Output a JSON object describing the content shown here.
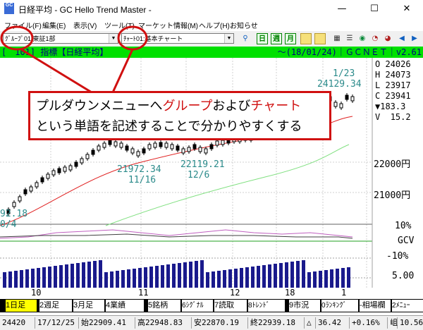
{
  "window": {
    "title": "日経平均 - GC Hello Trend Master -",
    "icon_text": "GC",
    "minimize": "—",
    "maximize": "☐",
    "close": "✕"
  },
  "menu": [
    "ファイル(F)",
    "編集(E)",
    "表示(V)",
    "ツール(T)",
    "マーケット情報(M)",
    "ヘルプ(H)",
    "お知らせ"
  ],
  "toolbar": {
    "group_label": "ｸﾞﾙｰﾌﾟ",
    "group_value": "01:東証1部",
    "chart_label": "ﾁｬｰﾄ",
    "chart_value": "01:基本チャート",
    "daily_icon": "日",
    "weekly_icon": "週",
    "monthly_icon": "月"
  },
  "chart_header": {
    "text": "[　101] 指標【日経平均】",
    "right_text": "～(18/01/24)｜ＧＣＮＥＴ｜v2.61"
  },
  "price_panel": {
    "O": "24026",
    "H": "24073",
    "L": "23917",
    "C": "23941",
    "change": "▼183.3",
    "volume_label": "V",
    "volume": "15.2",
    "o_label": "O",
    "h_label": "H",
    "l_label": "L",
    "c_label": "C"
  },
  "annotations": {
    "high_date": "1/23",
    "high_value": "24129.34",
    "low1_value": "21972.34",
    "low1_date": "11/16",
    "low2_value": "22119.21",
    "low2_date": "12/6",
    "left_value": "92.18",
    "left_date": "0/4"
  },
  "axis": {
    "y_22000": "22000円",
    "y_21000": "21000円",
    "osc_10": "10%",
    "osc_label": "GCV",
    "osc_m10": "-10%",
    "vol_5": "5.00",
    "x_labels": [
      "10",
      "11",
      "12",
      "18",
      "1"
    ]
  },
  "fkeys": [
    {
      "num": "1",
      "label": "日足",
      "bg": "#ffff00"
    },
    {
      "num": "2",
      "label": "週足",
      "bg": "#ffffff"
    },
    {
      "num": "3",
      "label": "月足",
      "bg": "#ffffff"
    },
    {
      "num": "4",
      "label": "業績",
      "bg": "#ffffff"
    },
    {
      "num": "5",
      "label": "銘柄",
      "bg": "#ffffff"
    },
    {
      "num": "6",
      "label": "ｼｸﾞﾅﾙ",
      "bg": "#ffffff"
    },
    {
      "num": "7",
      "label": "読取",
      "bg": "#ffffff"
    },
    {
      "num": "8",
      "label": "ﾄﾚﾝﾄﾞ",
      "bg": "#ffffff"
    },
    {
      "num": "9",
      "label": "市況",
      "bg": "#ffffff"
    },
    {
      "num": "0",
      "label": "ﾗﾝｷﾝｸﾞ",
      "bg": "#ffffff"
    },
    {
      "num": "-",
      "label": "相場欄",
      "bg": "#ffffff"
    },
    {
      "num": "2",
      "label": "ﾒﾆｭｰ",
      "bg": "#ffffff"
    }
  ],
  "status": {
    "count": "24420",
    "date": "17/12/25",
    "open": "始22909.41",
    "high": "高22948.83",
    "low": "安22870.19",
    "close": "終22939.18",
    "sign": "△",
    "change": "36.42",
    "pct": "+0.16%",
    "arrow": "岨",
    "vol": "10.56"
  },
  "callout": {
    "line1_pre": "プルダウンメニューへ",
    "line1_group": "グループ",
    "line1_mid": "および",
    "line1_chart": "チャート",
    "line2": "という単語を記述することで分かりやすくする"
  },
  "colors": {
    "header_bg": "#00e000",
    "header_text": "#000080",
    "accent_red": "#d01010",
    "teal": "#2a8a8a",
    "volume_bar": "#1a1a8c"
  }
}
